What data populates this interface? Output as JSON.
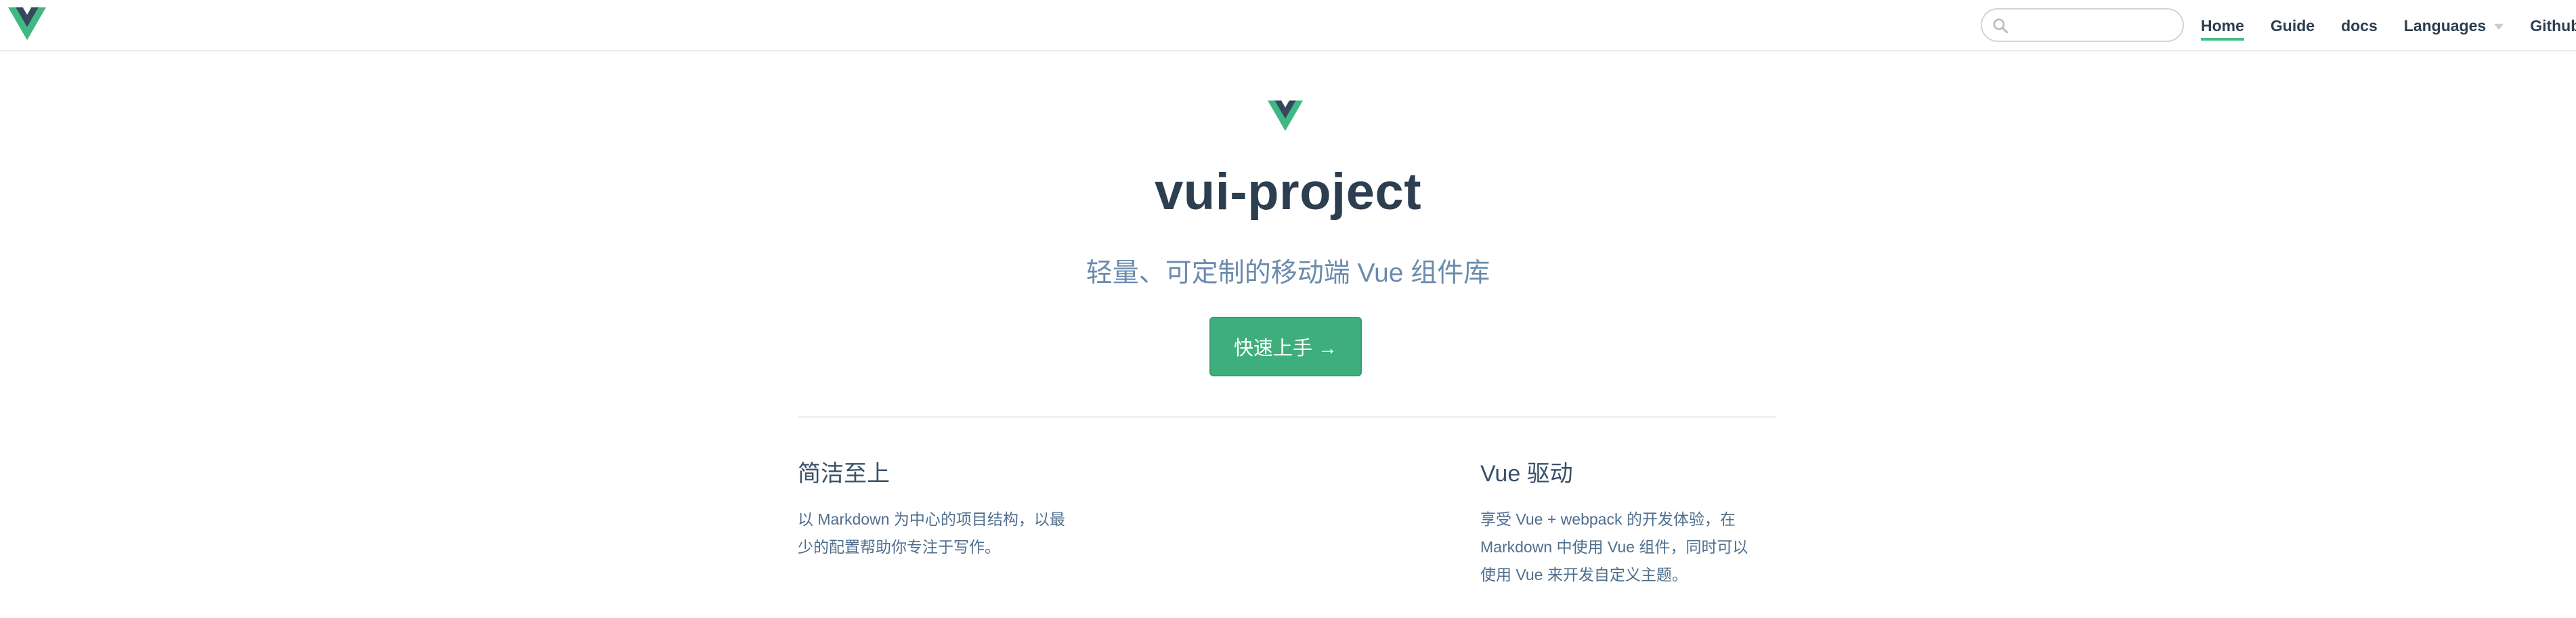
{
  "navbar": {
    "search": {
      "placeholder": "",
      "value": ""
    },
    "links": [
      {
        "label": "Home",
        "active": true
      },
      {
        "label": "Guide"
      },
      {
        "label": "docs"
      },
      {
        "label": "Languages",
        "dropdown": true
      },
      {
        "label": "Github",
        "external": true
      }
    ]
  },
  "hero": {
    "title": "vui-project",
    "description": "轻量、可定制的移动端 Vue 组件库",
    "action_label": "快速上手 →"
  },
  "features": [
    {
      "title": "简洁至上",
      "details_lines": [
        "以 Markdown 为中心的项目结构，以最",
        "少的配置帮助你专注于写作。"
      ]
    },
    {
      "title": "Vue 驱动",
      "details_lines": [
        "享受 Vue + webpack 的开发体验，在",
        "Markdown 中使用 Vue 组件，同时可以",
        "使用 Vue 来开发自定义主题。"
      ]
    }
  ],
  "colors": {
    "accent": "#3eaf7c",
    "logo_green": "#41b883",
    "logo_dark": "#35495e",
    "text": "#2c3e50",
    "description": "#6a8bad"
  },
  "icons": {
    "nav_logo": "vue-logo-icon",
    "search": "search-icon",
    "hero_logo": "vue-logo-icon",
    "external": "external-link-icon",
    "dropdown": "caret-down-icon"
  }
}
